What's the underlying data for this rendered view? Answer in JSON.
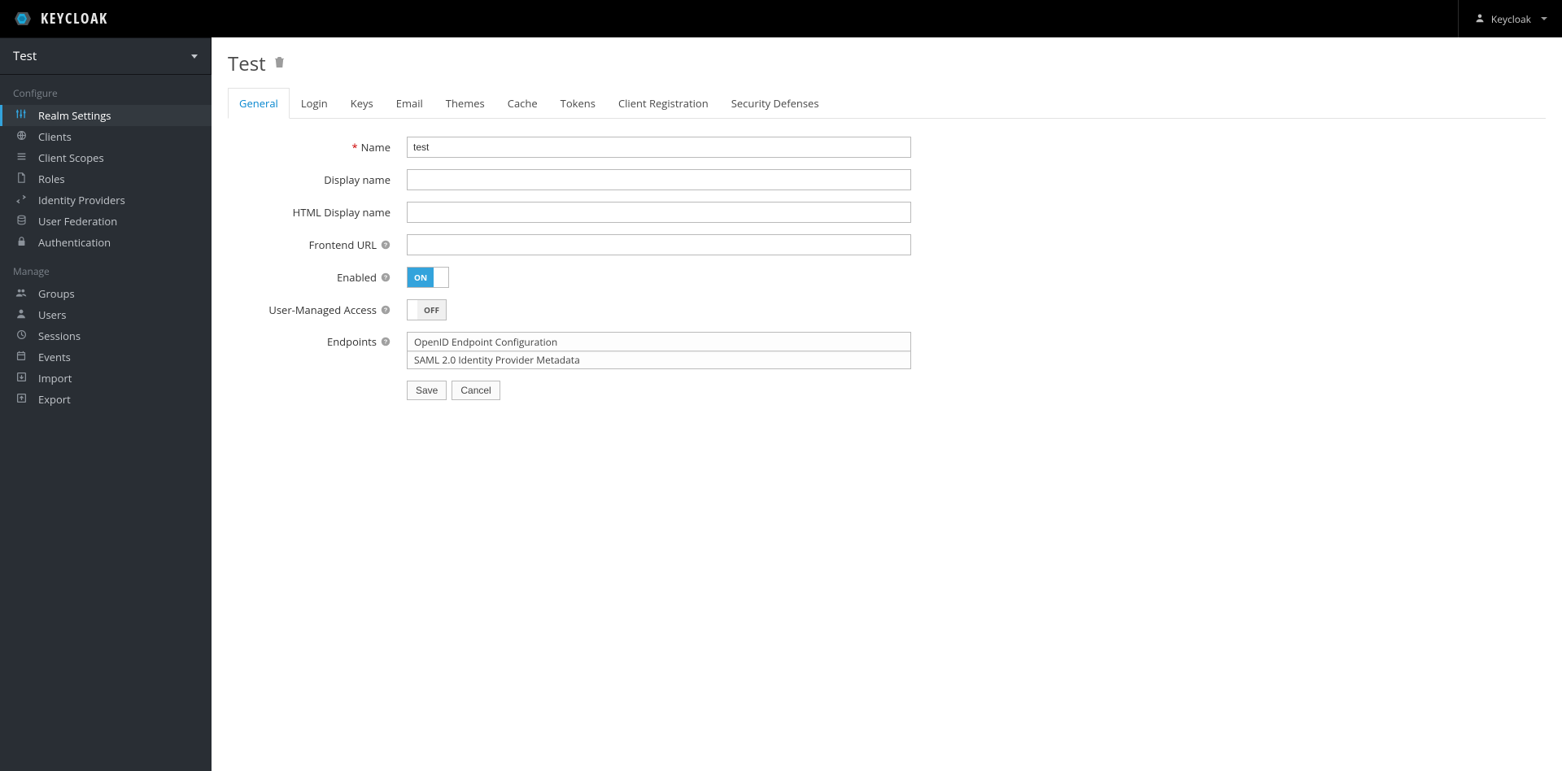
{
  "brand": {
    "name": "KEYCLOAK"
  },
  "topbar": {
    "user_label": "Keycloak"
  },
  "sidebar": {
    "realm_name": "Test",
    "section_configure": "Configure",
    "section_manage": "Manage",
    "items_configure": [
      {
        "label": "Realm Settings"
      },
      {
        "label": "Clients"
      },
      {
        "label": "Client Scopes"
      },
      {
        "label": "Roles"
      },
      {
        "label": "Identity Providers"
      },
      {
        "label": "User Federation"
      },
      {
        "label": "Authentication"
      }
    ],
    "items_manage": [
      {
        "label": "Groups"
      },
      {
        "label": "Users"
      },
      {
        "label": "Sessions"
      },
      {
        "label": "Events"
      },
      {
        "label": "Import"
      },
      {
        "label": "Export"
      }
    ]
  },
  "page": {
    "title": "Test"
  },
  "tabs": [
    "General",
    "Login",
    "Keys",
    "Email",
    "Themes",
    "Cache",
    "Tokens",
    "Client Registration",
    "Security Defenses"
  ],
  "form": {
    "labels": {
      "name": "Name",
      "display_name": "Display name",
      "html_display_name": "HTML Display name",
      "frontend_url": "Frontend URL",
      "enabled": "Enabled",
      "user_managed_access": "User-Managed Access",
      "endpoints": "Endpoints"
    },
    "values": {
      "name": "test",
      "display_name": "",
      "html_display_name": "",
      "frontend_url": "",
      "enabled": "ON",
      "user_managed_access": "OFF"
    },
    "toggle_labels": {
      "on": "ON",
      "off": "OFF"
    },
    "endpoints": [
      "OpenID Endpoint Configuration",
      "SAML 2.0 Identity Provider Metadata"
    ],
    "buttons": {
      "save": "Save",
      "cancel": "Cancel"
    }
  }
}
